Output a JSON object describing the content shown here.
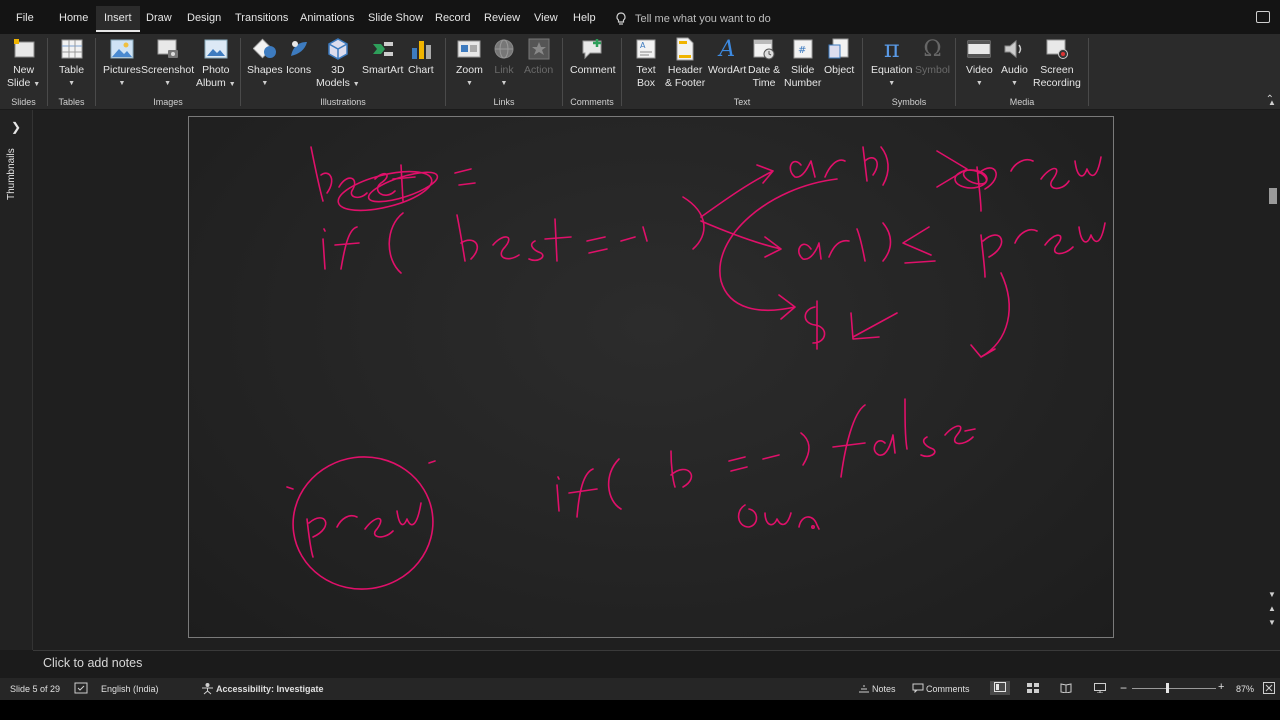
{
  "tabs": [
    "File",
    "Home",
    "Insert",
    "Draw",
    "Design",
    "Transitions",
    "Animations",
    "Slide Show",
    "Record",
    "Review",
    "View",
    "Help"
  ],
  "active_tab": "Insert",
  "tell_me": "Tell me what you want to do",
  "ribbon": {
    "slides": {
      "label": "Slides",
      "new_slide_1": "New",
      "new_slide_2": "Slide"
    },
    "tables": {
      "label": "Tables",
      "table": "Table"
    },
    "images": {
      "label": "Images",
      "pictures": "Pictures",
      "screenshot": "Screenshot",
      "photo_album_1": "Photo",
      "photo_album_2": "Album"
    },
    "illustrations": {
      "label": "Illustrations",
      "shapes": "Shapes",
      "icons": "Icons",
      "models_1": "3D",
      "models_2": "Models",
      "smartart": "SmartArt",
      "chart": "Chart"
    },
    "links": {
      "label": "Links",
      "zoom": "Zoom",
      "link": "Link",
      "action": "Action"
    },
    "comments": {
      "label": "Comments",
      "comment": "Comment"
    },
    "text": {
      "label": "Text",
      "textbox_1": "Text",
      "textbox_2": "Box",
      "header_1": "Header",
      "header_2": "& Footer",
      "wordart": "WordArt",
      "datetime_1": "Date &",
      "datetime_2": "Time",
      "slidenum_1": "Slide",
      "slidenum_2": "Number",
      "object": "Object"
    },
    "symbols": {
      "label": "Symbols",
      "equation": "Equation",
      "symbol": "Symbol"
    },
    "media": {
      "label": "Media",
      "video": "Video",
      "audio": "Audio",
      "screen_1": "Screen",
      "screen_2": "Recording"
    }
  },
  "thumbnails_label": "Thumbnails",
  "notes_placeholder": "Click to add notes",
  "status": {
    "slide": "Slide 5 of 29",
    "language": "English (India)",
    "accessibility": "Accessibility: Investigate",
    "notes": "Notes",
    "comments": "Comments",
    "zoom": "87%"
  },
  "ink_color": "#e0106a"
}
